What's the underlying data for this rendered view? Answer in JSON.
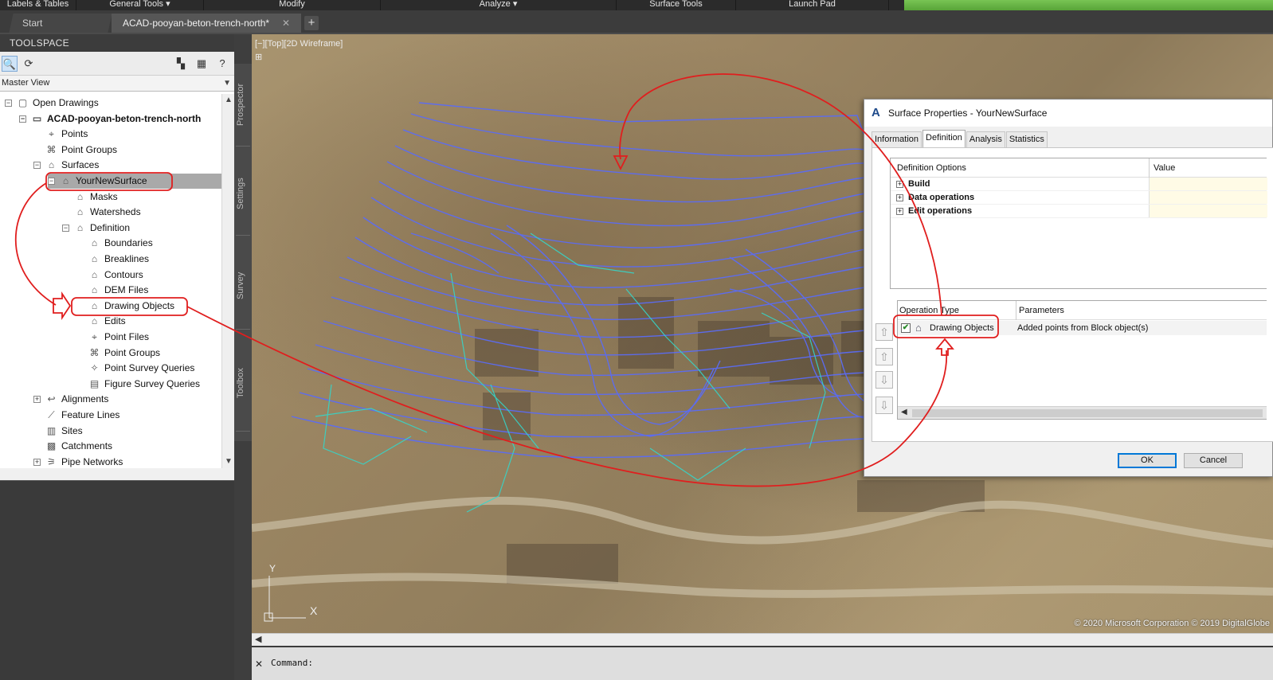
{
  "ribbon": {
    "segments": [
      "Labels & Tables",
      "General Tools ▾",
      "Modify",
      "Analyze ▾",
      "Surface Tools",
      "Launch Pad"
    ]
  },
  "tabs": {
    "start": "Start",
    "document": "ACAD-pooyan-beton-trench-north*",
    "close": "✕",
    "new": "+"
  },
  "toolspace": {
    "title": "TOOLSPACE",
    "view_select": "Master View",
    "side_tabs": [
      "Prospector",
      "Settings",
      "Survey",
      "Toolbox"
    ],
    "tree": [
      {
        "label": "Open Drawings",
        "level": 0,
        "expander": "−",
        "icon": "folder-icon"
      },
      {
        "label": "ACAD-pooyan-beton-trench-north",
        "level": 1,
        "expander": "−",
        "icon": "drawing-icon",
        "bold": true
      },
      {
        "label": "Points",
        "level": 2,
        "expander": "",
        "icon": "points-icon"
      },
      {
        "label": "Point Groups",
        "level": 2,
        "expander": "",
        "icon": "point-groups-icon"
      },
      {
        "label": "Surfaces",
        "level": 2,
        "expander": "−",
        "icon": "surfaces-icon"
      },
      {
        "label": "YourNewSurface",
        "level": 3,
        "expander": "−",
        "icon": "surface-icon",
        "selected": true
      },
      {
        "label": "Masks",
        "level": 4,
        "expander": "",
        "icon": "masks-icon"
      },
      {
        "label": "Watersheds",
        "level": 4,
        "expander": "",
        "icon": "watersheds-icon"
      },
      {
        "label": "Definition",
        "level": 4,
        "expander": "−",
        "icon": "definition-icon"
      },
      {
        "label": "Boundaries",
        "level": 5,
        "expander": "",
        "icon": "boundaries-icon"
      },
      {
        "label": "Breaklines",
        "level": 5,
        "expander": "",
        "icon": "breaklines-icon"
      },
      {
        "label": "Contours",
        "level": 5,
        "expander": "",
        "icon": "contours-icon"
      },
      {
        "label": "DEM Files",
        "level": 5,
        "expander": "",
        "icon": "dem-files-icon"
      },
      {
        "label": "Drawing Objects",
        "level": 5,
        "expander": "",
        "icon": "drawing-objects-icon"
      },
      {
        "label": "Edits",
        "level": 5,
        "expander": "",
        "icon": "edits-icon"
      },
      {
        "label": "Point Files",
        "level": 5,
        "expander": "",
        "icon": "point-files-icon"
      },
      {
        "label": "Point Groups",
        "level": 5,
        "expander": "",
        "icon": "point-groups-icon"
      },
      {
        "label": "Point Survey Queries",
        "level": 5,
        "expander": "",
        "icon": "point-survey-queries-icon"
      },
      {
        "label": "Figure Survey Queries",
        "level": 5,
        "expander": "",
        "icon": "figure-survey-queries-icon"
      },
      {
        "label": "Alignments",
        "level": 2,
        "expander": "+",
        "icon": "alignments-icon"
      },
      {
        "label": "Feature Lines",
        "level": 2,
        "expander": "",
        "icon": "feature-lines-icon"
      },
      {
        "label": "Sites",
        "level": 2,
        "expander": "",
        "icon": "sites-icon"
      },
      {
        "label": "Catchments",
        "level": 2,
        "expander": "",
        "icon": "catchments-icon"
      },
      {
        "label": "Pipe Networks",
        "level": 2,
        "expander": "+",
        "icon": "pipe-networks-icon"
      }
    ]
  },
  "viewport": {
    "label": "[−][Top][2D Wireframe]",
    "copyright": "© 2020 Microsoft Corporation © 2019 DigitalGlobe",
    "ucs_x": "X",
    "ucs_y": "Y"
  },
  "command_line": {
    "close": "✕",
    "prompt": "Command:"
  },
  "dialog": {
    "logo": "A",
    "title": "Surface Properties - YourNewSurface",
    "tabs": [
      "Information",
      "Definition",
      "Analysis",
      "Statistics"
    ],
    "active_tab": "Definition",
    "options_grid": {
      "header_left": "Definition Options",
      "header_right": "Value",
      "rows": [
        "Build",
        "Data operations",
        "Edit operations"
      ]
    },
    "operations_grid": {
      "header_left": "Operation Type",
      "header_right": "Parameters",
      "rows": [
        {
          "type": "Drawing Objects",
          "parameters": "Added points from Block object(s)",
          "checked": true
        }
      ]
    },
    "ok": "OK",
    "cancel": "Cancel"
  },
  "colors": {
    "annotation": "#e01e1e",
    "contour_major": "#5b6cf5",
    "contour_minor": "#35d6c9",
    "ribbon_active": "#6cbc4a"
  }
}
